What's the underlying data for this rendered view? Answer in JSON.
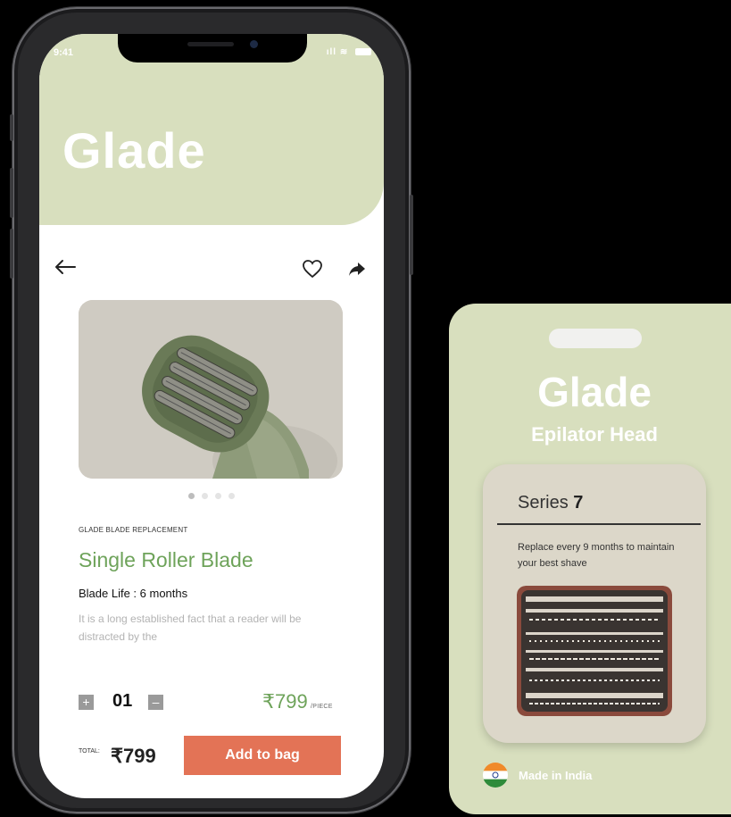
{
  "status_bar": {
    "time": "9:41",
    "icons": [
      "signal-icon",
      "wifi-icon",
      "battery-icon"
    ]
  },
  "brand": "Glade",
  "nav": {
    "back_icon": "arrow-left-icon",
    "favorite_icon": "heart-icon",
    "share_icon": "share-icon"
  },
  "product": {
    "image_pages": 4,
    "active_page": 1,
    "category": "GLADE BLADE REPLACEMENT",
    "name": "Single Roller Blade",
    "blade_life": "Blade Life : 6 months",
    "description": "It is a long established fact that a reader will be distracted by the",
    "quantity": "01",
    "plus_label": "+",
    "minus_label": "–",
    "price": "₹799",
    "price_unit": "/PIECE"
  },
  "footer": {
    "total_label": "TOTAL:",
    "total_value": "₹799",
    "add_button": "Add to bag"
  },
  "package": {
    "brand": "Glade",
    "subtitle": "Epilator Head",
    "series_prefix": "Series",
    "series_number": "7",
    "replace_text": "Replace every 9 months to maintain your best shave",
    "origin": "Made in India"
  },
  "colors": {
    "hero_bg": "#d8dfbe",
    "accent_green": "#6ea35a",
    "button_orange": "#e37356",
    "package_bg": "#d8dfbe"
  }
}
